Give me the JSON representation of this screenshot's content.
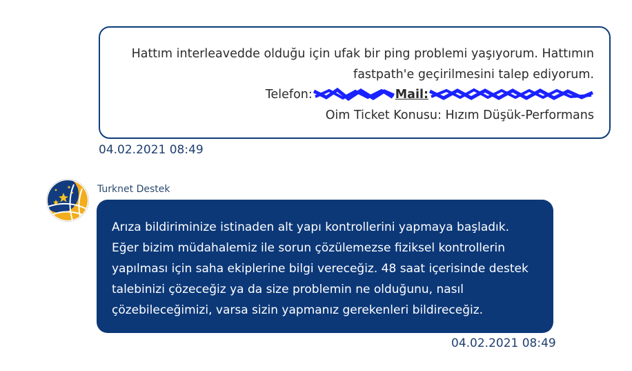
{
  "user_message": {
    "lines": [
      "Hattım interleavedde olduğu için ufak bir ping problemi yaşıyorum. Hattımın",
      "fastpath'e geçirilmesini talep ediyorum."
    ],
    "phone_label": "Telefon:",
    "mail_label": "Mail:",
    "ticket_line": "Oim Ticket Konusu: Hızım Düşük-Performans",
    "timestamp": "04.02.2021 08:49",
    "redaction_color": "#1a22ff"
  },
  "support_message": {
    "sender": "Turknet Destek",
    "lines": [
      "Arıza bildiriminize istinaden alt yapı kontrollerini yapmaya başladık.",
      "Eğer bizim müdahalemiz ile sorun çözülemezse fiziksel kontrollerin",
      "yapılması için saha ekiplerine bilgi vereceğiz. 48 saat içerisinde destek",
      "talebinizi çözeceğiz ya da size problemin ne olduğunu, nasıl",
      "çözebileceğimizi, varsa sizin yapmanız gerekenleri bildireceğiz."
    ],
    "timestamp": "04.02.2021 08:49",
    "bubble_color": "#0c3878",
    "avatar_icon": "turknet-logo-icon"
  }
}
